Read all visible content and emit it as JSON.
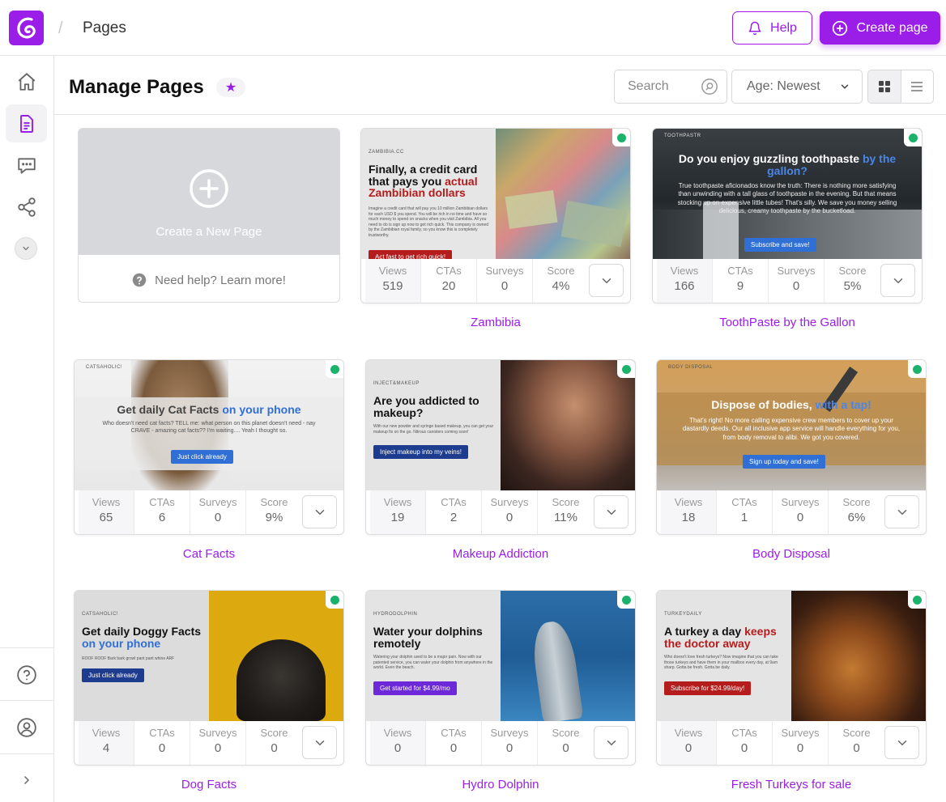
{
  "topbar": {
    "breadcrumb_sep": "/",
    "title": "Pages",
    "help_label": "Help",
    "create_label": "Create page"
  },
  "header": {
    "title": "Manage Pages",
    "star": "★",
    "search_placeholder": "Search",
    "sort_value": "Age: Newest"
  },
  "new_page": {
    "label": "Create a New Page",
    "help_label": "Need help? Learn more!"
  },
  "stat_labels": {
    "views": "Views",
    "ctas": "CTAs",
    "surveys": "Surveys",
    "score": "Score"
  },
  "pages": [
    {
      "name": "Zambibia",
      "views": "519",
      "ctas": "20",
      "surveys": "0",
      "score": "4%",
      "thumb": {
        "brand": "ZAMBIBIA.CC",
        "headline_a": "Finally, a credit card that pays you",
        "headline_b": "actual Zambibian dollars",
        "body": "Imagine a credit card that will pay you 10 million Zambibian dollars for each USD $ you spend. You will be rich in no time and have so much money to spend on snacks when you visit Zambibia. All you need to do is sign up now to get rich quick. This company is owned by the Zambibian royal family, so you know this is completely trustworthy.",
        "button": "Act fast to get rich quick!"
      }
    },
    {
      "name": "ToothPaste by the Gallon",
      "views": "166",
      "ctas": "9",
      "surveys": "0",
      "score": "5%",
      "thumb": {
        "brand": "TOOTHPASTR",
        "headline_a": "Do you enjoy guzzling toothpaste",
        "headline_b": "by the gallon?",
        "body": "True toothpaste aficionados know the truth: There is nothing more satisfying than unwinding with a tall glass of toothpaste in the evening. But that means stocking up on expensive little tubes! That's silly. We save you money selling delicious, creamy toothpaste by the bucketload.",
        "button": "Subscribe and save!"
      }
    },
    {
      "name": "Cat Facts",
      "views": "65",
      "ctas": "6",
      "surveys": "0",
      "score": "9%",
      "thumb": {
        "brand": "CATSAHOLIC!",
        "headline_a": "Get daily Cat Facts",
        "headline_b": "on your phone",
        "body": "Who doesn't need cat facts? TELL me: what person on this planet doesn't need - nay CRAVE - amazing cat facts?? I'm waiting.... Yeah I thought so.",
        "button": "Just click already"
      }
    },
    {
      "name": "Makeup Addiction",
      "views": "19",
      "ctas": "2",
      "surveys": "0",
      "score": "11%",
      "thumb": {
        "brand": "INJECT&MAKEUP",
        "headline_a": "Are you addicted to makeup?",
        "headline_b": "",
        "body": "With our new powder and syringe based makeup, you can get your makeup fix on the go. Nitrous canisters coming soon!",
        "button": "Inject makeup into my veins!"
      }
    },
    {
      "name": "Body Disposal",
      "views": "18",
      "ctas": "1",
      "surveys": "0",
      "score": "6%",
      "thumb": {
        "brand": "BODY DISPOSAL",
        "headline_a": "Dispose of bodies,",
        "headline_b": "with a tap!",
        "body": "That's right! No more calling expensive crew members to cover up your dastardly deeds. Our all inclusive app service will handle everything for you, from body removal to alibi. We got you covered.",
        "button": "Sign up today and save!"
      }
    },
    {
      "name": "Dog Facts",
      "views": "4",
      "ctas": "0",
      "surveys": "0",
      "score": "0",
      "thumb": {
        "brand": "CATSAHOLIC!",
        "headline_a": "Get daily Doggy Facts",
        "headline_b": "on your phone",
        "body": "ROOF ROOF Bark bark growl pant pant whine ARF",
        "button": "Just click already"
      }
    },
    {
      "name": "Hydro Dolphin",
      "views": "0",
      "ctas": "0",
      "surveys": "0",
      "score": "0",
      "thumb": {
        "brand": "HYDRODOLPHIN",
        "headline_a": "Water your dolphins remotely",
        "headline_b": "",
        "body": "Watering your dolphin used to be a major pain. Now with our patented service, you can water your dolphin from anywhere in the world. Even the beach.",
        "button": "Get started for $4.99/mo"
      }
    },
    {
      "name": "Fresh Turkeys for sale",
      "views": "0",
      "ctas": "0",
      "surveys": "0",
      "score": "0",
      "thumb": {
        "brand": "TURKEYDAILY",
        "headline_a": "A turkey a day",
        "headline_b": "keeps the doctor away",
        "body": "Who doesn't love fresh turkeys? Now imagine that you can take those turkeys and have them in your mailbox every day, at 9am sharp. Gotta be fresh. Gotta be daily.",
        "button": "Subscribe for $24.99/day!"
      }
    }
  ],
  "colors": {
    "accent": "#9b1ee8",
    "status_live": "#1bb36b"
  },
  "icons": {
    "logo": "logo-icon",
    "help": "bell-icon",
    "create": "plus-circle-icon",
    "home": "home-icon",
    "pages": "document-icon",
    "comments": "chat-icon",
    "share": "share-icon",
    "more": "chevron-down-icon",
    "support": "question-icon",
    "account": "user-icon",
    "expand": "chevron-right-icon"
  }
}
